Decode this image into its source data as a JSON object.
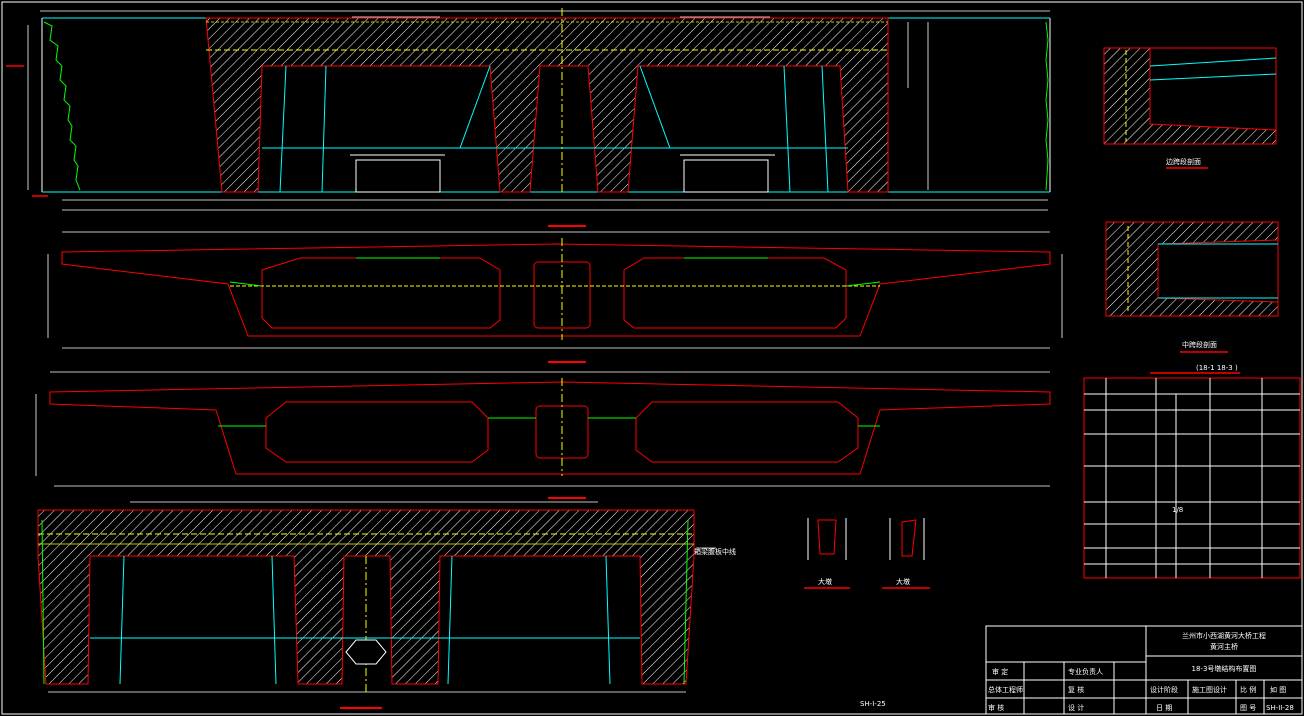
{
  "project": {
    "title": "兰州市小西湖黄河大桥工程",
    "subtitle": "黄河主桥",
    "drawing_name": "18-3号墩结构布置图",
    "sheet_label": "SH-I-25"
  },
  "section_labels": {
    "side_span": "边跨段剖面",
    "mid_span": "中跨段剖面",
    "plan_note": "(18-1 18-3  )",
    "big_pier": "大墩",
    "small_pier": "大墩",
    "guide_line": "箱梁腹板中线"
  },
  "misc_marks": {
    "table_mark": "1/8"
  },
  "title_block": {
    "review": "审 定",
    "lead_engineer": "专业负责人",
    "project_director": "总体工程师",
    "check": "复 核",
    "design_stage_label": "设计阶段",
    "design_stage_value": "施工图设计",
    "scale_label": "比 例",
    "scale_value": "如 图",
    "reviewer": "审 核",
    "designer": "设 计",
    "date_label": "日 期",
    "sheet_no_label": "图 号",
    "sheet_no_value": "SH-II-28"
  }
}
